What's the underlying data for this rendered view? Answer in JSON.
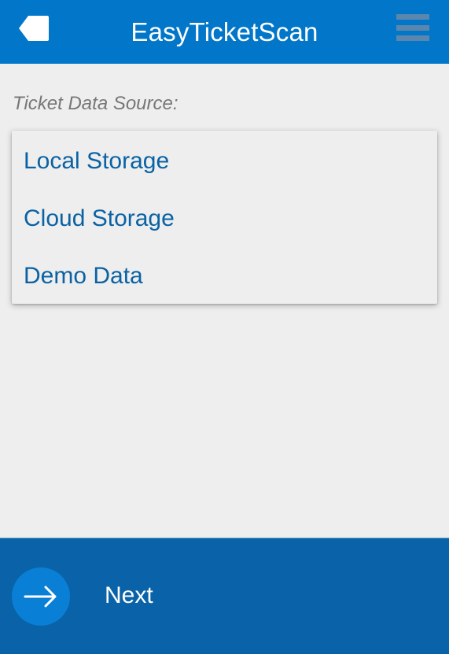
{
  "app_bar": {
    "title": "EasyTicketScan",
    "back_icon": "back-tag-icon",
    "menu_icon": "hamburger-menu-icon",
    "background_color": "#0277c9"
  },
  "source_section": {
    "label": "Ticket Data Source:",
    "options": [
      {
        "label": "Local Storage"
      },
      {
        "label": "Cloud Storage"
      },
      {
        "label": "Demo Data"
      }
    ]
  },
  "bottom_bar": {
    "next_label": "Next",
    "next_icon": "arrow-right-icon",
    "background_color": "#0a63a8"
  }
}
